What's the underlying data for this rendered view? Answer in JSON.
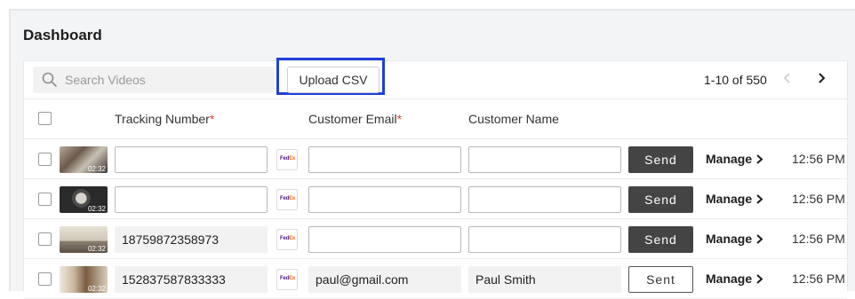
{
  "page": {
    "title": "Dashboard"
  },
  "toolbar": {
    "search_placeholder": "Search Videos",
    "upload_label": "Upload CSV",
    "pagination": "1-10 of 550"
  },
  "table": {
    "headers": {
      "tracking": "Tracking Number",
      "email": "Customer Email",
      "name": "Customer Name",
      "required_mark": "*"
    },
    "rows": [
      {
        "duration": "02:32",
        "tracking": "",
        "carrier": "FedEx",
        "email": "",
        "name": "",
        "send_label": "Send",
        "manage_label": "Manage",
        "time": "12:56 PM"
      },
      {
        "duration": "02:32",
        "tracking": "",
        "carrier": "FedEx",
        "email": "",
        "name": "",
        "send_label": "Send",
        "manage_label": "Manage",
        "time": "12:56 PM"
      },
      {
        "duration": "02:32",
        "tracking": "18759872358973",
        "carrier": "FedEx",
        "email": "",
        "name": "",
        "send_label": "Send",
        "manage_label": "Manage",
        "time": "12:56 PM"
      },
      {
        "duration": "02:32",
        "tracking": "152837587833333",
        "carrier": "FedEx",
        "email": "paul@gmail.com",
        "name": "Paul Smith",
        "send_label": "Sent",
        "manage_label": "Manage",
        "time": "12:56 PM"
      }
    ]
  },
  "colors": {
    "highlight": "#1f3fd9",
    "send_dark": "#444444",
    "required": "#e0413d",
    "fedex_purple": "#4d148c",
    "fedex_orange": "#ff6600"
  },
  "icons": {
    "search": "search-icon",
    "prev": "chevron-left-icon",
    "next": "chevron-right-icon",
    "manage": "chevron-right-icon"
  }
}
